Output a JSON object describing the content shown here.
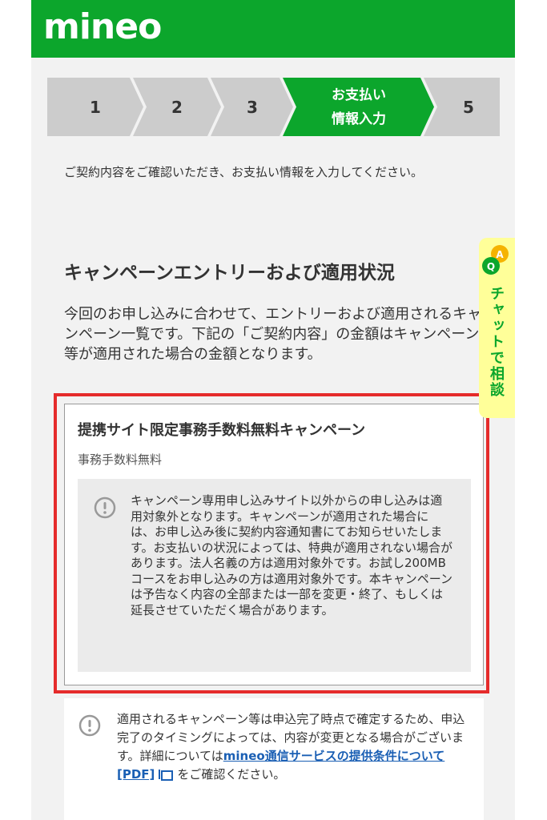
{
  "header": {
    "logo": "mineo"
  },
  "stepper": {
    "steps": [
      {
        "label": "1",
        "active": false
      },
      {
        "label": "2",
        "active": false
      },
      {
        "label": "3",
        "active": false
      },
      {
        "label_line1": "お支払い",
        "label_line2": "情報入力",
        "active": true
      },
      {
        "label": "5",
        "active": false
      }
    ],
    "colors": {
      "active": "#0ca62c",
      "inactive": "#cccccc"
    }
  },
  "intro": "ご契約内容をご確認いただき、お支払い情報を入力してください。",
  "section": {
    "title": "キャンペーンエントリーおよび適用状況",
    "description": "今回のお申し込みに合わせて、エントリーおよび適用されるキャンペーン一覧です。下記の「ご契約内容」の金額はキャンペーン等が適用された場合の金額となります。"
  },
  "campaign": {
    "title": "提携サイト限定事務手数料無料キャンペーン",
    "subtitle": "事務手数料無料",
    "notice": "キャンペーン専用申し込みサイト以外からの申し込みは適用対象外となります。キャンペーンが適用された場合には、お申し込み後に契約内容通知書にてお知らせいたします。お支払いの状況によっては、特典が適用されない場合があります。法人名義の方は適用対象外です。お試し200MBコースをお申し込みの方は適用対象外です。本キャンペーンは予告なく内容の全部または一部を変更・終了、もしくは延長させていただく場合があります。"
  },
  "bottom_notice": {
    "text_before": "適用されるキャンペーン等は申込完了時点で確定するため、申込完了のタイミングによっては、内容が変更となる場合がございます。詳細については",
    "link_text": "mineo通信サービスの提供条件について[PDF]",
    "text_after": "をご確認ください。"
  },
  "chat": {
    "badge_a": "A",
    "badge_q": "Q",
    "label": "チャットで相談"
  },
  "colors": {
    "brand_green": "#0ca62c",
    "highlight_red": "#e52b2b",
    "chat_yellow": "#ffff99",
    "link_blue": "#1a5fb4"
  }
}
